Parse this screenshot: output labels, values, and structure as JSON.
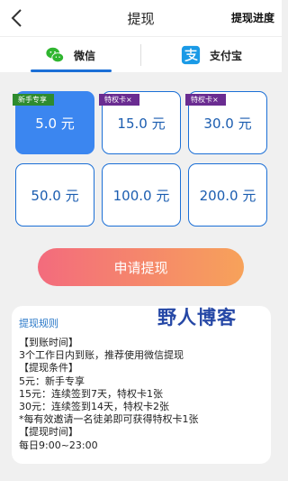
{
  "header": {
    "title": "提现",
    "progress_label": "提现进度"
  },
  "tabs": [
    {
      "label": "微信",
      "icon": "wechat-icon"
    },
    {
      "label": "支付宝",
      "icon": "alipay-icon"
    }
  ],
  "colors": {
    "accent": "#1b6fd6",
    "selected_card": "#3b86f0",
    "badge_green": "#2e8b2e",
    "badge_purple": "#6a2c91",
    "button_gradient_start": "#f36b7d",
    "button_gradient_end": "#f7a25a"
  },
  "amounts": [
    {
      "label": "5.0 元",
      "badge": "新手专享",
      "selected": true
    },
    {
      "label": "15.0 元",
      "badge": "特权卡×"
    },
    {
      "label": "30.0 元",
      "badge": "特权卡×"
    },
    {
      "label": "50.0 元"
    },
    {
      "label": "100.0 元"
    },
    {
      "label": "200.0 元"
    }
  ],
  "apply_button": "申请提现",
  "rules": {
    "title": "提现规则",
    "watermark": "野人博客",
    "lines": [
      "【到账时间】",
      "3个工作日内到账，推荐使用微信提现",
      "【提现条件】",
      "5元：新手专享",
      "15元：连续签到7天，特权卡1张",
      "30元：连续签到14天，特权卡2张",
      "*每有效邀请一名徒弟即可获得特权卡1张",
      "【提现时间】",
      "每日9:00~23:00"
    ]
  }
}
